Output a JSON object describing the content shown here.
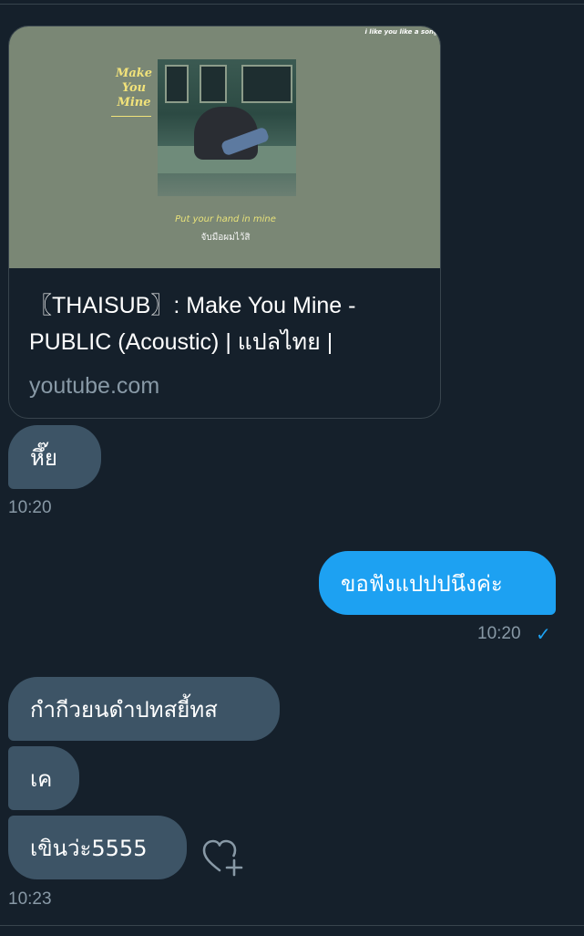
{
  "link_card": {
    "thumbnail": {
      "corner_text": "i like you like a song",
      "album_title": "Make\nYou\nMine",
      "lyric_en": "Put your hand in mine",
      "lyric_th": "จับมือผมไว้สิ"
    },
    "title": "〖THAISUB〗: Make You Mine - PUBLIC (Acoustic) | แปลไทย |",
    "domain": "youtube.com"
  },
  "messages": [
    {
      "side": "received",
      "text": "หึ๊ย"
    },
    {
      "side": "received_time",
      "text": "10:20"
    },
    {
      "side": "sent",
      "text": "ขอฟังแปปปนึงค่ะ"
    },
    {
      "side": "sent_time",
      "text": "10:20",
      "read_icon": "check-icon"
    },
    {
      "side": "received",
      "text": "กำกีวยนดำปทสยี้ทส"
    },
    {
      "side": "received",
      "text": "เค"
    },
    {
      "side": "received",
      "text": "เขินว่ะ5555"
    },
    {
      "side": "received_time",
      "text": "10:23"
    }
  ],
  "reaction": {
    "icon": "heart-plus-icon"
  },
  "colors": {
    "background": "#15202b",
    "received_bubble": "#3d5466",
    "sent_bubble": "#1da1f2",
    "timestamp": "#8899a6",
    "divider": "#38444d"
  }
}
